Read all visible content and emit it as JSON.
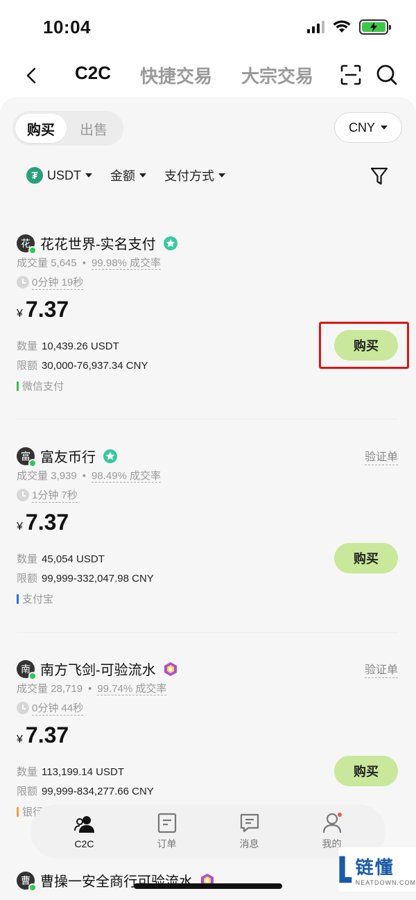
{
  "status_bar": {
    "time": "10:04"
  },
  "nav": {
    "tabs": [
      {
        "label": "C2C",
        "active": true
      },
      {
        "label": "快捷交易",
        "active": false
      },
      {
        "label": "大宗交易",
        "active": false
      }
    ],
    "icons": [
      "back-icon",
      "scan-icon",
      "search-icon"
    ]
  },
  "toolbar": {
    "segment": {
      "buy": "购买",
      "sell": "出售",
      "selected": "buy"
    },
    "currency": "CNY"
  },
  "filters": {
    "asset": "USDT",
    "amount": "金额",
    "payment": "支付方式"
  },
  "labels": {
    "volume": "成交量",
    "rate_suffix": "成交率",
    "quantity": "数量",
    "limit": "限额",
    "currency_symbol": "¥",
    "verify": "验证单",
    "buy": "购买"
  },
  "merchants": [
    {
      "avatar": "花",
      "name": "花花世界-实名支付",
      "badge": "green-star-badge-icon",
      "volume": "5,645",
      "rate": "99.98%",
      "time": "0分钟 19秒",
      "price": "7.37",
      "quantity": "10,439.26 USDT",
      "limit": "30,000-76,937.34 CNY",
      "payment": "微信支付",
      "payment_color": "#3fba4f",
      "has_verify": false,
      "highlighted": true
    },
    {
      "avatar": "富",
      "name": "富友币行",
      "badge": "green-star-badge-icon",
      "volume": "3,939",
      "rate": "98.49%",
      "time": "1分钟 7秒",
      "price": "7.37",
      "quantity": "45,054 USDT",
      "limit": "99,999-332,047.98 CNY",
      "payment": "支付宝",
      "payment_color": "#2a6fdb",
      "has_verify": true,
      "highlighted": false
    },
    {
      "avatar": "南",
      "name": "南方飞剑-可验流水",
      "badge": "purple-diamond-badge-icon",
      "volume": "28,719",
      "rate": "99.74%",
      "time": "0分钟 44秒",
      "price": "7.37",
      "quantity": "113,199.14 USDT",
      "limit": "99,999-834,277.66 CNY",
      "payment": "银行",
      "payment_color": "#f0a040",
      "has_verify": true,
      "highlighted": false
    },
    {
      "avatar": "曹",
      "name": "曹操一安全商行可验流水",
      "badge": "purple-diamond-badge-icon"
    }
  ],
  "tabbar": {
    "items": [
      {
        "label": "C2C",
        "icon": "users-icon",
        "active": true
      },
      {
        "label": "订单",
        "icon": "order-icon",
        "active": false
      },
      {
        "label": "消息",
        "icon": "message-icon",
        "active": false
      },
      {
        "label": "我的",
        "icon": "profile-icon",
        "active": false
      }
    ]
  },
  "watermark": {
    "cn": "链懂",
    "en": "NEATDOWN.COM"
  }
}
